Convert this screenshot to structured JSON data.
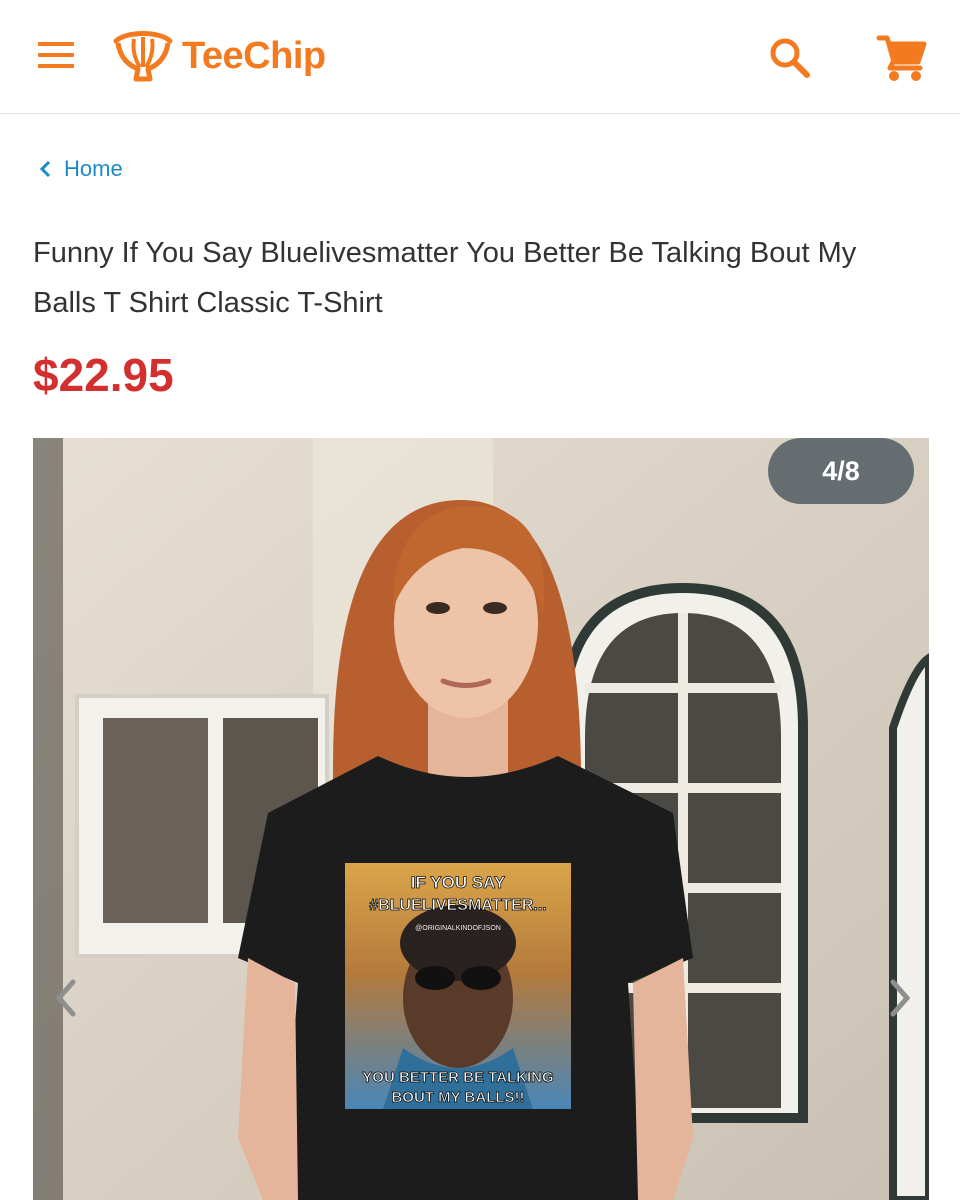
{
  "header": {
    "brand": "TeeChip",
    "menu_icon": "hamburger-menu-icon",
    "search_icon": "search-icon",
    "cart_icon": "shopping-cart-icon",
    "brand_color": "#f47a20"
  },
  "breadcrumb": {
    "home_label": "Home",
    "link_color": "#1c8ac6"
  },
  "product": {
    "title": "Funny If You Say Bluelivesmatter You Better Be Talking Bout My Balls T Shirt Classic T-Shirt",
    "price": "$22.95",
    "price_color": "#d32f2f"
  },
  "gallery": {
    "counter": "4/8",
    "current_index": 4,
    "total": 8,
    "prev_icon": "chevron-left-icon",
    "next_icon": "chevron-right-icon",
    "shirt_print": {
      "top_line_1": "IF YOU SAY",
      "top_line_2": "#BLUELIVESMATTER...",
      "credit": "@ORIGINALKINDOFJSON",
      "bottom_line_1": "YOU BETTER BE TALKING",
      "bottom_line_2": "BOUT MY BALLS!!"
    }
  }
}
